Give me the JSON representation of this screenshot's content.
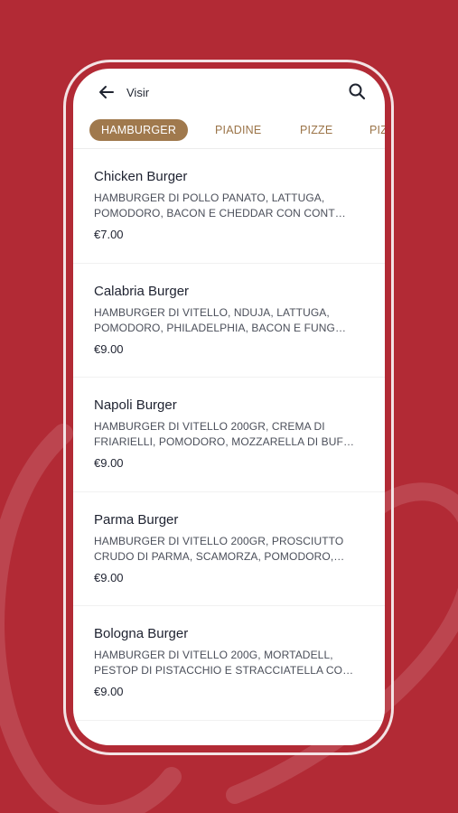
{
  "colors": {
    "background": "#b22a35",
    "accent": "#a0794d",
    "screen": "#ffffff"
  },
  "header": {
    "title": "Visir",
    "back_icon": "arrow-left-icon",
    "search_icon": "search-icon"
  },
  "tabs": [
    {
      "label": "HAMBURGER",
      "active": true
    },
    {
      "label": "PIADINE",
      "active": false
    },
    {
      "label": "PIZZE",
      "active": false
    },
    {
      "label": "PIZ",
      "active": false
    }
  ],
  "items": [
    {
      "name": "Chicken Burger",
      "description": "HAMBURGER DI POLLO PANATO, LATTUGA, POMODORO, BACON E CHEDDAR CON CONT…",
      "price": "€7.00"
    },
    {
      "name": "Calabria Burger",
      "description": "HAMBURGER DI VITELLO, NDUJA, LATTUGA, POMODORO, PHILADELPHIA, BACON E FUNG…",
      "price": "€9.00"
    },
    {
      "name": "Napoli Burger",
      "description": "HAMBURGER DI VITELLO 200GR, CREMA DI FRIARIELLI, POMODORO, MOZZARELLA DI BUF…",
      "price": "€9.00"
    },
    {
      "name": "Parma Burger",
      "description": "HAMBURGER DI VITELLO 200GR, PROSCIUTTO CRUDO DI PARMA, SCAMORZA, POMODORO,…",
      "price": "€9.00"
    },
    {
      "name": "Bologna Burger",
      "description": "HAMBURGER DI VITELLO 200G, MORTADELL, PESTOP DI PISTACCHIO E STRACCIATELLA CO…",
      "price": "€9.00"
    }
  ]
}
